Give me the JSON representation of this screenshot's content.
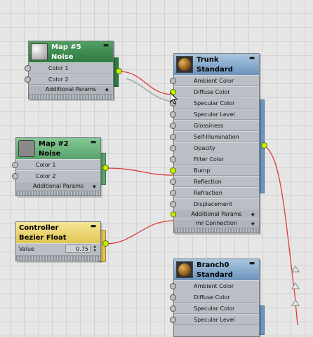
{
  "nodes": {
    "map5": {
      "name": "Map #5",
      "type": "Noise",
      "rows": [
        "Color 1",
        "Color 2"
      ],
      "footer": "Additional Params",
      "thumbnail": "noise-swatch",
      "color": "#2e7a40"
    },
    "map2": {
      "name": "Map #2",
      "type": "Noise",
      "rows": [
        "Color 1",
        "Color 2"
      ],
      "footer": "Additional Params",
      "thumbnail": "gray-swatch",
      "color": "#5aa36c"
    },
    "controller": {
      "name": "Controller",
      "type": "Bezier Float",
      "param_label": "Value",
      "param_value": "0.75",
      "color": "#e1c455"
    },
    "trunk": {
      "name": "Trunk",
      "type": "Standard",
      "thumbnail": "brown-sphere",
      "color": "#6b93bb",
      "rows": [
        "Ambient Color",
        "Diffuse Color",
        "Specular Color",
        "Specular Level",
        "Glossiness",
        "Self-Illumination",
        "Opacity",
        "Filter Color",
        "Bump",
        "Reflection",
        "Refraction",
        "Displacement"
      ],
      "footer1": "Additional Params",
      "footer2": "mr Connection"
    },
    "branch": {
      "name": "Branch0",
      "type": "Standard",
      "thumbnail": "brown-sphere",
      "color": "#6b93bb",
      "rows": [
        "Ambient Color",
        "Diffuse Color",
        "Specular Color",
        "Specular Level"
      ]
    }
  },
  "glyphs": {
    "minimize": "▬",
    "expand": "◆",
    "spin_up": "▲",
    "spin_down": "▼"
  },
  "wire_color": "#e03a3a",
  "connections": [
    {
      "from": "Map #5",
      "to": "Trunk.Diffuse Color"
    },
    {
      "from": "Map #2",
      "to": "Trunk.Bump"
    },
    {
      "from": "Controller Bezier Float",
      "to": "Trunk.Additional Params"
    },
    {
      "from": "Trunk",
      "to": "Branch0"
    }
  ]
}
